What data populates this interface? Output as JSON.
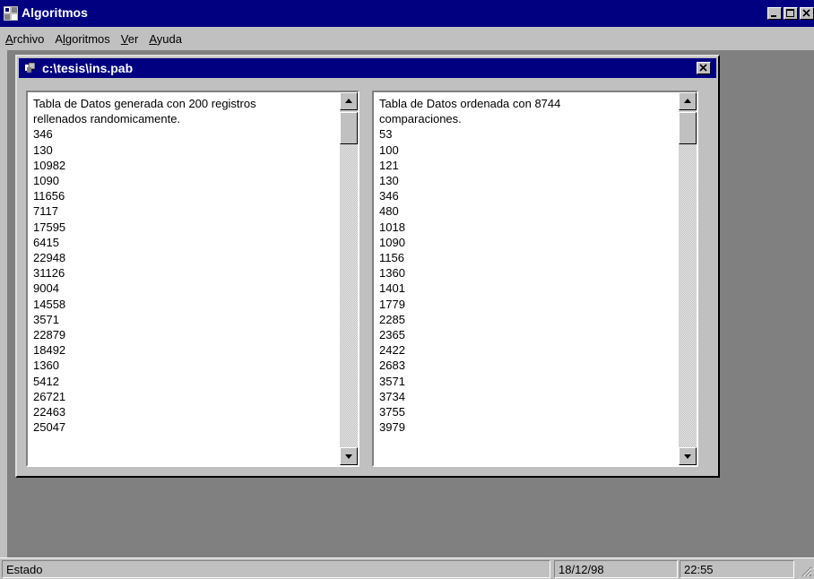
{
  "app": {
    "title": "Algoritmos"
  },
  "menu": [
    {
      "label": "Archivo"
    },
    {
      "label": "Algoritmos"
    },
    {
      "label": "Ver"
    },
    {
      "label": "Ayuda"
    }
  ],
  "child_window": {
    "title": "c:\\tesis\\ins.pab"
  },
  "left_list": {
    "lines": [
      "Tabla de Datos generada con 200 registros",
      "rellenados randomicamente.",
      "346",
      "130",
      "10982",
      "1090",
      "11656",
      "7117",
      "17595",
      "6415",
      "22948",
      "31126",
      "9004",
      "14558",
      "3571",
      "22879",
      "18492",
      "1360",
      "5412",
      "26721",
      "22463",
      "25047"
    ]
  },
  "right_list": {
    "lines": [
      "Tabla de Datos ordenada con 8744",
      "comparaciones.",
      "53",
      "100",
      "121",
      "130",
      "346",
      "480",
      "1018",
      "1090",
      "1156",
      "1360",
      "1401",
      "1779",
      "2285",
      "2365",
      "2422",
      "2683",
      "3571",
      "3734",
      "3755",
      "3979"
    ]
  },
  "status": {
    "state": "Estado",
    "date": "18/12/98",
    "time": "22:55"
  },
  "colors": {
    "titlebar": "#000080",
    "face": "#c0c0c0",
    "mdi_bg": "#808080"
  },
  "icons": [
    "app-icon",
    "minimize-icon",
    "maximize-icon",
    "close-icon",
    "child-window-icon",
    "scroll-up-icon",
    "scroll-down-icon",
    "resize-grip-icon"
  ]
}
